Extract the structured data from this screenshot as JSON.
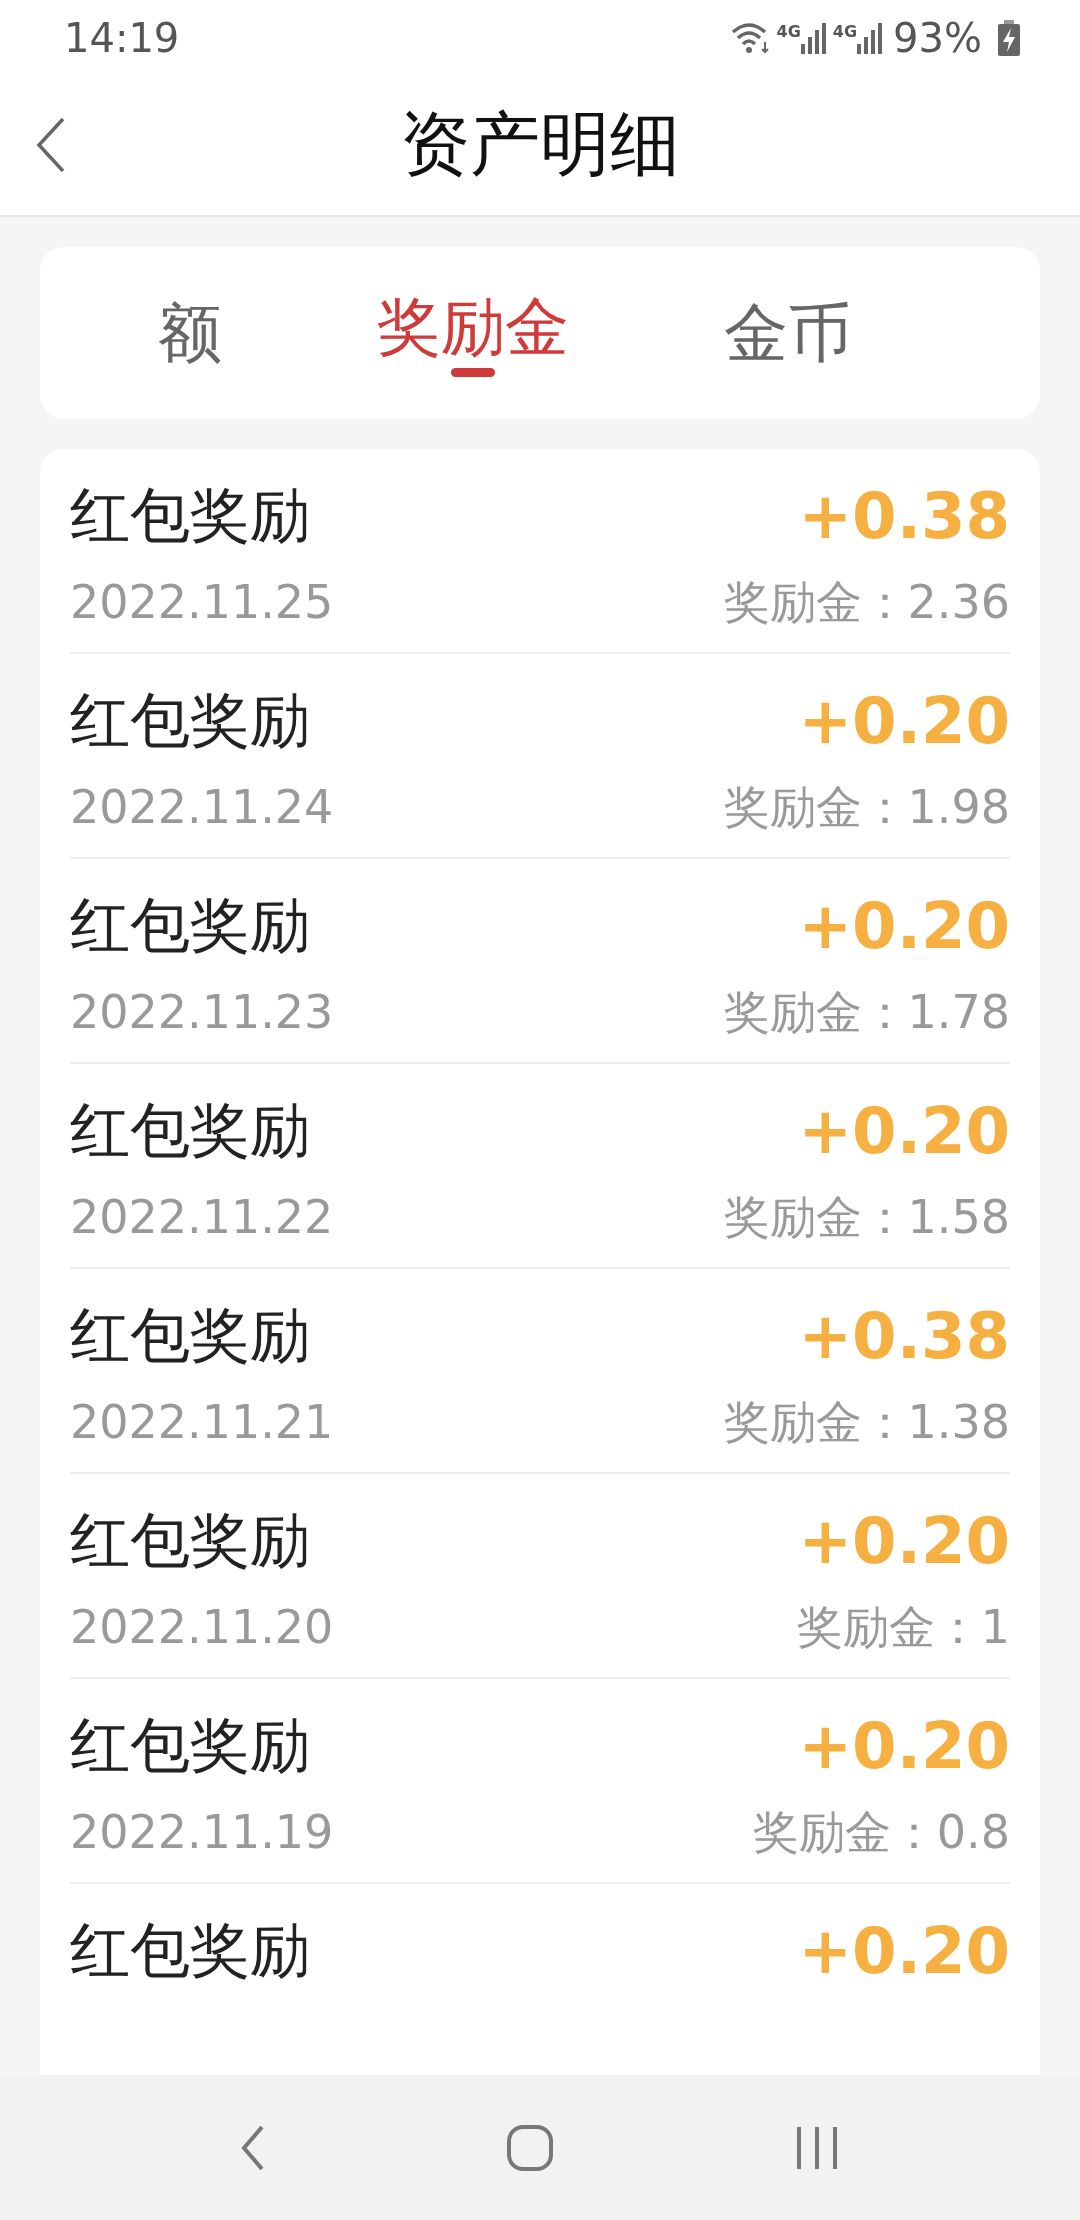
{
  "status_bar": {
    "time": "14:19",
    "networks": [
      "4G",
      "4G"
    ],
    "battery": "93%"
  },
  "header": {
    "title": "资产明细"
  },
  "tabs": [
    {
      "label": "额",
      "selected": false
    },
    {
      "label": "奖励金",
      "selected": true
    },
    {
      "label": "金币",
      "selected": false
    }
  ],
  "records": [
    {
      "title": "红包奖励",
      "amount": "+0.38",
      "date": "2022.11.25",
      "balance": "奖励金：2.36"
    },
    {
      "title": "红包奖励",
      "amount": "+0.20",
      "date": "2022.11.24",
      "balance": "奖励金：1.98"
    },
    {
      "title": "红包奖励",
      "amount": "+0.20",
      "date": "2022.11.23",
      "balance": "奖励金：1.78"
    },
    {
      "title": "红包奖励",
      "amount": "+0.20",
      "date": "2022.11.22",
      "balance": "奖励金：1.58"
    },
    {
      "title": "红包奖励",
      "amount": "+0.38",
      "date": "2022.11.21",
      "balance": "奖励金：1.38"
    },
    {
      "title": "红包奖励",
      "amount": "+0.20",
      "date": "2022.11.20",
      "balance": "奖励金：1"
    },
    {
      "title": "红包奖励",
      "amount": "+0.20",
      "date": "2022.11.19",
      "balance": "奖励金：0.8"
    },
    {
      "title": "红包奖励",
      "amount": "+0.20"
    }
  ]
}
